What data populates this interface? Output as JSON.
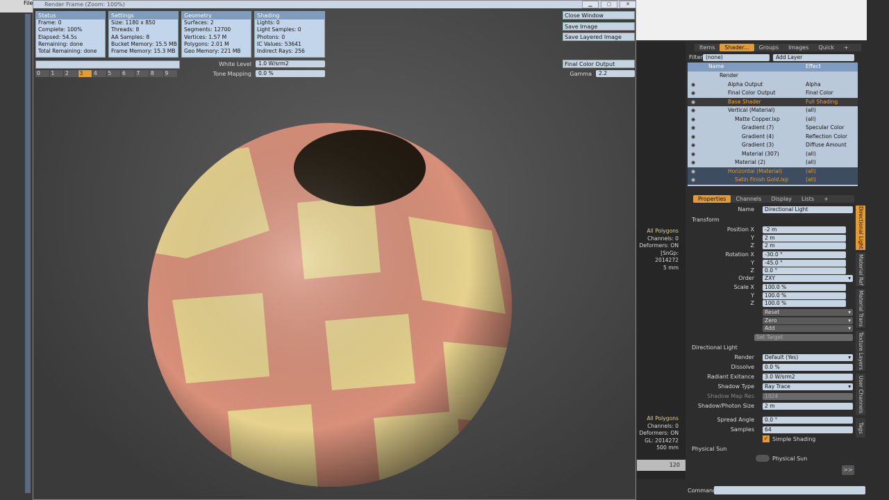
{
  "window": {
    "title": "Render Frame (Zoom: 100%)"
  },
  "app": {
    "menu_file": "File"
  },
  "status": {
    "header": "Status",
    "rows": [
      "Frame: 0",
      "Complete: 100%",
      "Elapsed: 54.5s",
      "Remaining: done",
      "Total Remaining: done"
    ]
  },
  "settings": {
    "header": "Settings",
    "rows": [
      "Size: 1180 x 850",
      "Threads: 8",
      "AA Samples: 8",
      "Bucket Memory: 15.5 MB",
      "Frame Memory: 15.3 MB"
    ]
  },
  "geometry": {
    "header": "Geometry",
    "rows": [
      "Surfaces: 2",
      "Segments: 12700",
      "Vertices: 1.57 M",
      "Polygons: 2.01 M",
      "Geo Memory: 221 MB"
    ]
  },
  "shading": {
    "header": "Shading",
    "rows": [
      "Lights: 0",
      "Light Samples: 0",
      "Photons: 0",
      "IC Values: 53641",
      "Indirect Rays: 256"
    ]
  },
  "frames": [
    "0",
    "1",
    "2",
    "3",
    "4",
    "5",
    "6",
    "7",
    "8",
    "9"
  ],
  "white_level": {
    "label": "White Level",
    "value": "1.0 W/srm2"
  },
  "tone_mapping": {
    "label": "Tone Mapping",
    "value": "0.0 %"
  },
  "buttons": {
    "close": "Close Window",
    "save": "Save Image",
    "save_layered": "Save Layered Image"
  },
  "output": {
    "value": "Final Color Output",
    "gamma_label": "Gamma",
    "gamma_value": "2.2"
  },
  "tabs_top": [
    "Items",
    "Shader...",
    "Groups",
    "Images",
    "Quick",
    "+"
  ],
  "filter": {
    "label": "Filter",
    "value": "(none)",
    "add_layer": "Add Layer"
  },
  "tree_headers": {
    "name": "Name",
    "effect": "Effect"
  },
  "tree": [
    {
      "name": "Render",
      "effect": ""
    },
    {
      "name": "Alpha Output",
      "effect": "Alpha"
    },
    {
      "name": "Final Color Output",
      "effect": "Final Color"
    },
    {
      "name": "Base Shader",
      "effect": "Full Shading"
    },
    {
      "name": "Vertical (Material)",
      "effect": "(all)"
    },
    {
      "name": "Matte Copper.lxp",
      "effect": "(all)"
    },
    {
      "name": "Gradient (7)",
      "effect": "Specular Color"
    },
    {
      "name": "Gradient (4)",
      "effect": "Reflection Color"
    },
    {
      "name": "Gradient (3)",
      "effect": "Diffuse Amount"
    },
    {
      "name": "Material (307)",
      "effect": "(all)"
    },
    {
      "name": "Material (2)",
      "effect": "(all)"
    },
    {
      "name": "Horizontal (Material)",
      "effect": "(all)"
    },
    {
      "name": "Satin Finish Gold.lxp",
      "effect": "(all)"
    }
  ],
  "tabs_props": [
    "Properties",
    "Channels",
    "Display",
    "Lists",
    "+"
  ],
  "vp1": [
    "All Polygons",
    "Channels: 0",
    "Deformers: ON",
    "[SnGp: 2014272",
    "5 mm"
  ],
  "vp2": [
    "All Polygons",
    "Channels: 0",
    "Deformers: ON",
    "GL: 2014272",
    "500 mm"
  ],
  "ruler": "120",
  "props": {
    "name_label": "Name",
    "name_value": "Directional Light",
    "transform": "Transform",
    "pos_label": "Position X",
    "pos": [
      "-2 m",
      "2 m",
      "2 m"
    ],
    "rot_label": "Rotation X",
    "rot": [
      "-30.0 °",
      "-45.0 °",
      "0.0 °"
    ],
    "order_label": "Order",
    "order": "ZXY",
    "scale_label": "Scale X",
    "scale": [
      "100.0 %",
      "100.0 %",
      "100.0 %"
    ],
    "y": "Y",
    "z": "Z",
    "reset": "Reset",
    "zero": "Zero",
    "add": "Add",
    "set_target": "Set Target",
    "dir_light": "Directional Light",
    "render_label": "Render",
    "render": "Default (Yes)",
    "dissolve_label": "Dissolve",
    "dissolve": "0.0 %",
    "rad_label": "Radiant Exitance",
    "rad": "3.0 W/srm2",
    "shadow_label": "Shadow Type",
    "shadow": "Ray Trace",
    "smap_label": "Shadow Map Res",
    "smap": "1024",
    "ssize_label": "Shadow/Photon Size",
    "ssize": "2 m",
    "spread_label": "Spread Angle",
    "spread": "0.0 °",
    "samples_label": "Samples",
    "samples": "64",
    "simple": "Simple Shading",
    "phys_section": "Physical Sun",
    "phys": "Physical Sun",
    "more": ">>"
  },
  "vtabs": [
    "Directional Light",
    "Material Ref",
    "Material Trans",
    "Texture Layers",
    "User Channels",
    "Tags"
  ],
  "command_label": "Command",
  "colors": {
    "accent": "#e49b33",
    "panel": "#c3d5ea",
    "copper": "#d8907a",
    "gold": "#e6d28e"
  }
}
